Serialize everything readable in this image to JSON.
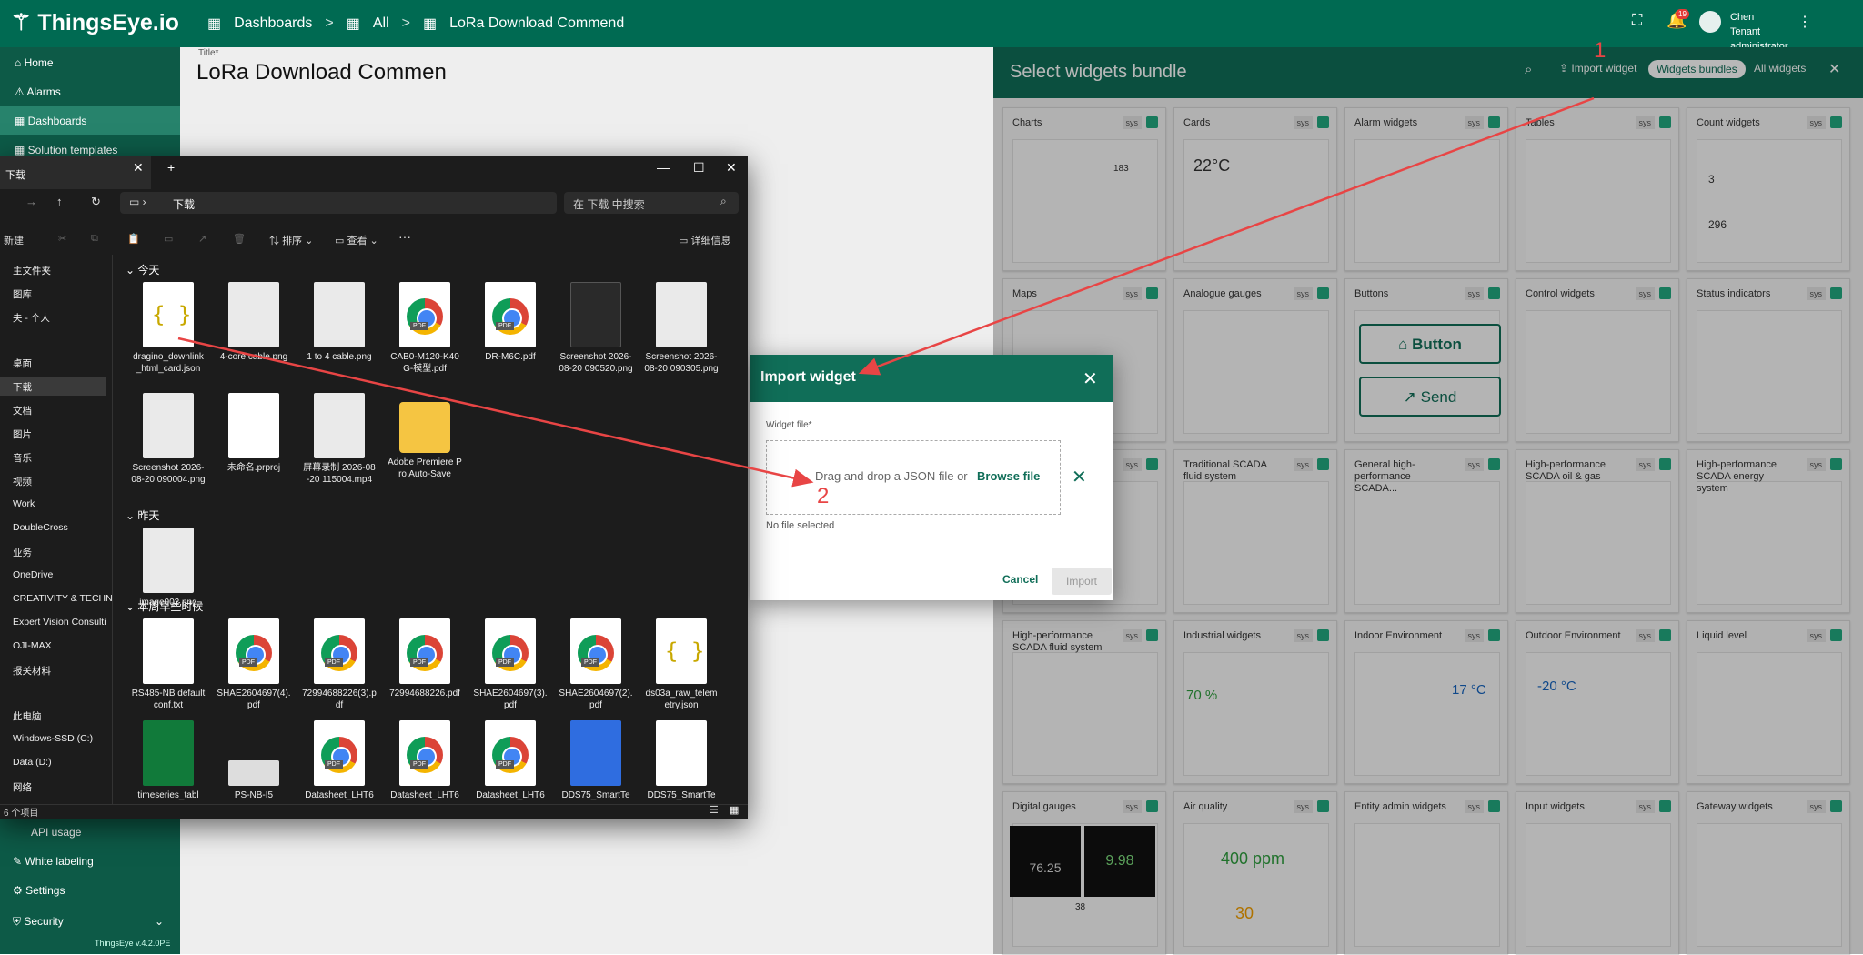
{
  "app": {
    "logo": "ThingsEye.io",
    "breadcrumbs": [
      "Dashboards",
      "All",
      "LoRa Download Commend"
    ],
    "user_name": "Chen",
    "user_role": "Tenant administrator",
    "notif_count": "19",
    "version": "ThingsEye v.4.2.0PE"
  },
  "sidebar": {
    "top": [
      "Home",
      "Alarms",
      "Dashboards",
      "Solution templates"
    ],
    "bottom": [
      "API usage",
      "White labeling",
      "Settings",
      "Security"
    ]
  },
  "dashboard": {
    "title_label": "Title*",
    "title": "LoRa Download Commen"
  },
  "panel": {
    "title": "Select widgets bundle",
    "import_label": "Import widget",
    "bundles_label": "Widgets bundles",
    "all_label": "All widgets",
    "sys": "sys",
    "cards": [
      "Charts",
      "Cards",
      "Alarm widgets",
      "Tables",
      "Count widgets",
      "Maps",
      "Analogue gauges",
      "Buttons",
      "Control widgets",
      "Status indicators",
      "",
      "Traditional SCADA fluid system",
      "General high-performance SCADA...",
      "High-performance SCADA oil & gas",
      "High-performance SCADA energy system",
      "High-performance SCADA fluid system",
      "Industrial widgets",
      "Indoor Environment",
      "Outdoor Environment",
      "Liquid level",
      "Digital gauges",
      "Air quality",
      "Entity admin widgets",
      "Input widgets",
      "Gateway widgets"
    ],
    "previews": {
      "button_label": "Button",
      "send_label": "Send",
      "temp_card": "22°C",
      "donut_value": "183",
      "count_total": "3",
      "count_device": "296",
      "indoor_temp": "17 °C",
      "outdoor_temp": "-20 °C",
      "efficiency": "70 %",
      "air_co2": "400 ppm",
      "air_pm": "30",
      "digital_a": "76.25",
      "digital_b": "9.98",
      "humidity": "38"
    }
  },
  "dialog": {
    "title": "Import widget",
    "field_label": "Widget file*",
    "drop_text": "Drag and drop a JSON file or",
    "browse": "Browse file",
    "no_file": "No file selected",
    "cancel": "Cancel",
    "import": "Import"
  },
  "explorer": {
    "tab": "下载",
    "address": "下载",
    "search_placeholder": "在 下载 中搜索",
    "toolbar": [
      "新建",
      "排序",
      "查看",
      "详细信息"
    ],
    "side": [
      "主文件夹",
      "图库",
      "夫 - 个人",
      "桌面",
      "下载",
      "文档",
      "图片",
      "音乐",
      "视频",
      "Work",
      "DoubleCross",
      "业务",
      "OneDrive",
      "CREATIVITY & TECHN",
      "Expert Vision Consulti",
      "OJI-MAX",
      "报关材料",
      "此电脑",
      "Windows-SSD (C:)",
      "Data (D:)",
      "网络"
    ],
    "group_today": "今天",
    "group_yesterday": "昨天",
    "group_week": "本周早些时候",
    "files_today": [
      {
        "name": "dragino_downlink_html_card.json",
        "type": "json"
      },
      {
        "name": "4-core cable.png",
        "type": "img"
      },
      {
        "name": "1 to 4 cable.png",
        "type": "img"
      },
      {
        "name": "CAB0-M120-K40G-模型.pdf",
        "type": "pdf"
      },
      {
        "name": "DR-M6C.pdf",
        "type": "pdf"
      },
      {
        "name": "Screenshot 2026-08-20 090520.png",
        "type": "dark"
      },
      {
        "name": "Screenshot 2026-08-20 090305.png",
        "type": "img"
      },
      {
        "name": "Screenshot 2026-08-20 090004.png",
        "type": "img"
      },
      {
        "name": "未命名.prproj",
        "type": "blank"
      },
      {
        "name": "屏幕录制 2026-08-20 115004.mp4",
        "type": "img"
      },
      {
        "name": "Adobe Premiere Pro Auto-Save",
        "type": "folder"
      }
    ],
    "files_yesterday": [
      {
        "name": "image002.png",
        "type": "img"
      }
    ],
    "files_week": [
      {
        "name": "RS485-NB default conf.txt",
        "type": "blank"
      },
      {
        "name": "SHAE2604697(4).pdf",
        "type": "pdf"
      },
      {
        "name": "72994688226(3).pdf",
        "type": "pdf"
      },
      {
        "name": "72994688226.pdf",
        "type": "pdf"
      },
      {
        "name": "SHAE2604697(3).pdf",
        "type": "pdf"
      },
      {
        "name": "SHAE2604697(2).pdf",
        "type": "pdf"
      },
      {
        "name": "ds03a_raw_telemetry.json",
        "type": "json"
      },
      {
        "name": "timeseries_tabl",
        "type": "xls"
      },
      {
        "name": "PS-NB-I5",
        "type": "strip"
      },
      {
        "name": "Datasheet_LHT6",
        "type": "pdf"
      },
      {
        "name": "Datasheet_LHT6",
        "type": "pdf"
      },
      {
        "name": "Datasheet_LHT6",
        "type": "pdf"
      },
      {
        "name": "DDS75_SmartTe",
        "type": "doc"
      },
      {
        "name": "DDS75_SmartTe",
        "type": "blank"
      }
    ],
    "status": "6 个项目"
  },
  "annotations": {
    "one": "1",
    "two": "2"
  },
  "colors": {
    "primary": "#106e58",
    "arrow": "#e84545"
  }
}
